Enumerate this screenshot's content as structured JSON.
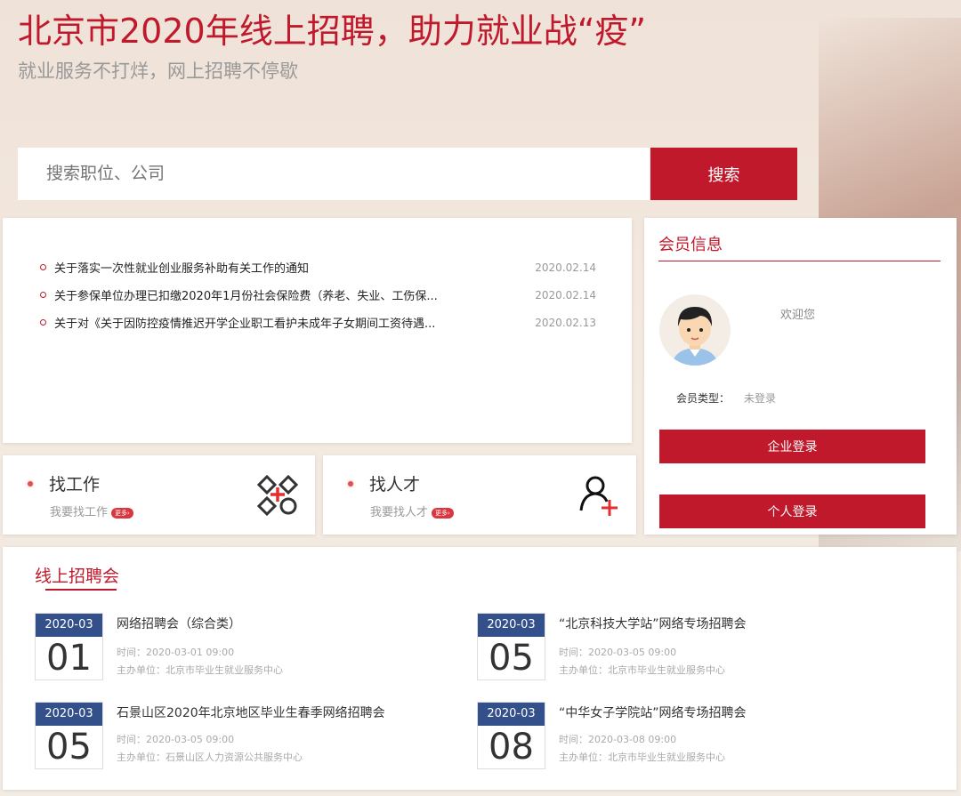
{
  "header": {
    "title": "北京市2020年线上招聘，助力就业战“疫”",
    "subtitle": "就业服务不打烊，网上招聘不停歇"
  },
  "search": {
    "placeholder": "搜索职位、公司",
    "button": "搜索"
  },
  "news": [
    {
      "title": "关于落实一次性就业创业服务补助有关工作的通知",
      "date": "2020.02.14"
    },
    {
      "title": "关于参保单位办理已扣缴2020年1月份社会保险费（养老、失业、工伤保...",
      "date": "2020.02.14"
    },
    {
      "title": "关于对《关于因防控疫情推迟开学企业职工看护未成年子女期间工资待遇...",
      "date": "2020.02.13"
    }
  ],
  "member": {
    "title": "会员信息",
    "welcome": "欢迎您",
    "type_label": "会员类型：",
    "type_value": "未登录",
    "company_login": "企业登录",
    "personal_login": "个人登录"
  },
  "cards": [
    {
      "title": "找工作",
      "sub": "我要找工作",
      "badge": "更多›"
    },
    {
      "title": "找人才",
      "sub": "我要找人才",
      "badge": "更多›"
    }
  ],
  "fairs": {
    "title": "线上招聘会",
    "items": [
      {
        "month": "2020-03",
        "day": "01",
        "title": "网络招聘会（综合类）",
        "time": "时间：2020-03-01 09:00",
        "org": "主办单位：北京市毕业生就业服务中心"
      },
      {
        "month": "2020-03",
        "day": "05",
        "title": "“北京科技大学站”网络专场招聘会",
        "time": "时间：2020-03-05 09:00",
        "org": "主办单位：北京市毕业生就业服务中心"
      },
      {
        "month": "2020-03",
        "day": "05",
        "title": "石景山区2020年北京地区毕业生春季网络招聘会",
        "time": "时间：2020-03-05 09:00",
        "org": "主办单位：石景山区人力资源公共服务中心"
      },
      {
        "month": "2020-03",
        "day": "08",
        "title": "“中华女子学院站”网络专场招聘会",
        "time": "时间：2020-03-08 09:00",
        "org": "主办单位：北京市毕业生就业服务中心"
      }
    ]
  }
}
